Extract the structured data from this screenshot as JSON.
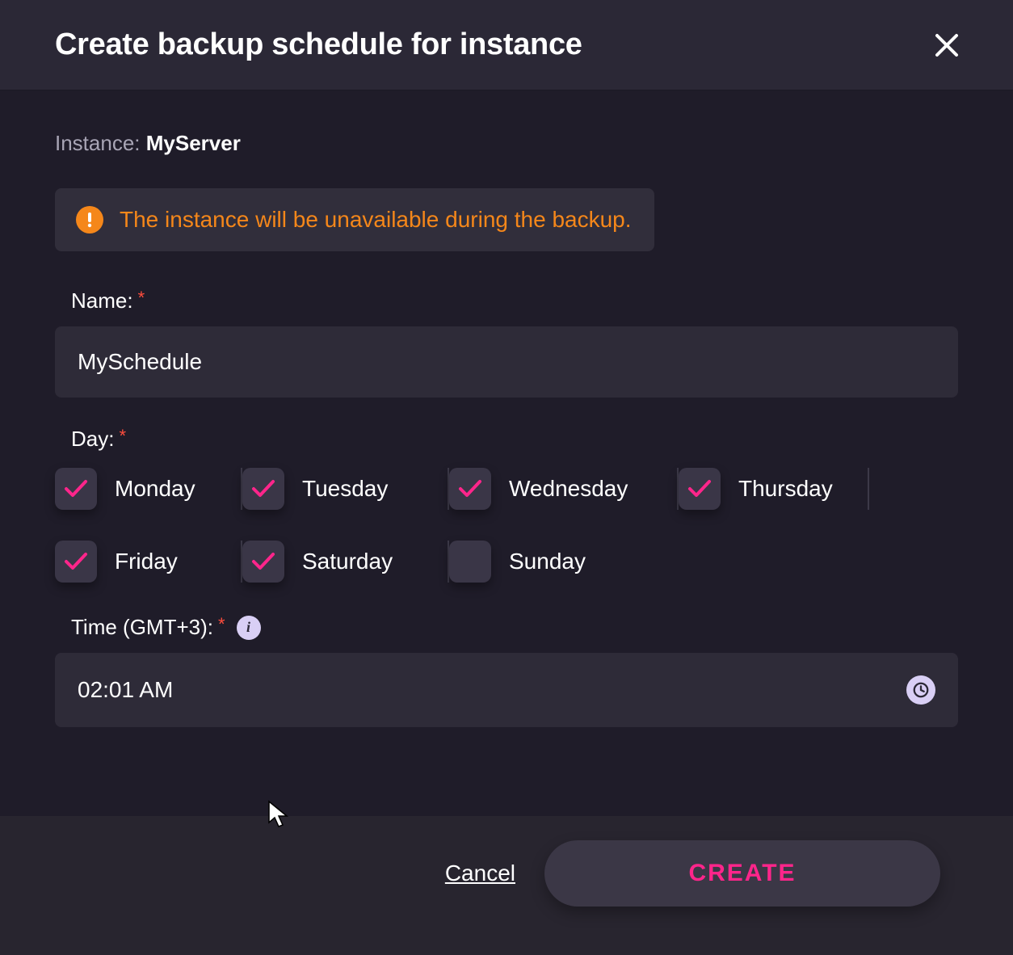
{
  "header": {
    "title": "Create backup schedule for instance"
  },
  "instance": {
    "label": "Instance:",
    "name": "MyServer"
  },
  "alert": {
    "text": "The instance will be unavailable during the backup."
  },
  "fields": {
    "name_label": "Name:",
    "name_value": "MySchedule",
    "day_label": "Day:",
    "time_label": "Time (GMT+3):",
    "time_value": "02:01 AM"
  },
  "days": [
    {
      "label": "Monday",
      "checked": true
    },
    {
      "label": "Tuesday",
      "checked": true
    },
    {
      "label": "Wednesday",
      "checked": true
    },
    {
      "label": "Thursday",
      "checked": true
    },
    {
      "label": "Friday",
      "checked": true
    },
    {
      "label": "Saturday",
      "checked": true
    },
    {
      "label": "Sunday",
      "checked": false
    }
  ],
  "footer": {
    "cancel": "Cancel",
    "create": "CREATE"
  }
}
